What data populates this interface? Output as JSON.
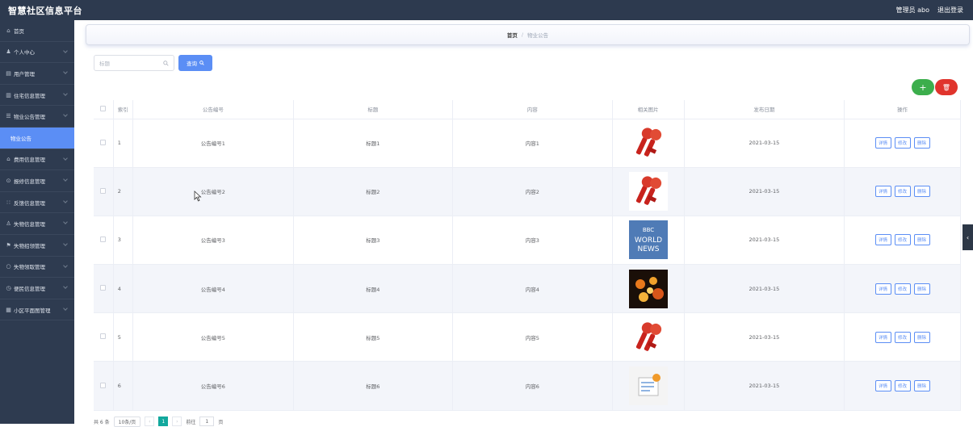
{
  "header": {
    "app_title": "智慧社区信息平台",
    "user_label": "管理员 abo",
    "logout": "退出登录"
  },
  "sidebar": {
    "items": [
      {
        "icon": "home-icon",
        "glyph": "⌂",
        "label": "首页",
        "chevron": false
      },
      {
        "icon": "user-icon",
        "glyph": "♟",
        "label": "个人中心",
        "chevron": true
      },
      {
        "icon": "users-icon",
        "glyph": "▤",
        "label": "用户管理",
        "chevron": true
      },
      {
        "icon": "building-icon",
        "glyph": "▥",
        "label": "住宅信息管理",
        "chevron": true
      },
      {
        "icon": "notice-icon",
        "glyph": "☰",
        "label": "物业公告管理",
        "chevron": true
      },
      {
        "label": "物业公告",
        "active": true,
        "chevron": false
      },
      {
        "icon": "bank-icon",
        "glyph": "⌂",
        "label": "费用信息管理",
        "chevron": true
      },
      {
        "icon": "repair-icon",
        "glyph": "⊙",
        "label": "报修信息管理",
        "chevron": true
      },
      {
        "icon": "feedback-icon",
        "glyph": "∷",
        "label": "反馈信息管理",
        "chevron": true
      },
      {
        "icon": "lost-icon",
        "glyph": "♙",
        "label": "失物信息管理",
        "chevron": true
      },
      {
        "icon": "flag-icon",
        "glyph": "⚑",
        "label": "失物招领管理",
        "chevron": true
      },
      {
        "icon": "claim-icon",
        "glyph": "○",
        "label": "失物领取管理",
        "chevron": true
      },
      {
        "icon": "clock-icon",
        "glyph": "◷",
        "label": "便民信息管理",
        "chevron": true
      },
      {
        "icon": "map-icon",
        "glyph": "▦",
        "label": "小区平面图管理",
        "chevron": true
      }
    ]
  },
  "breadcrumb": {
    "home": "首页",
    "sep": "/",
    "current": "物业公告"
  },
  "search": {
    "placeholder": "标题",
    "button": "查询"
  },
  "actions": {
    "add": "+",
    "delete": "🗑"
  },
  "table": {
    "headers": {
      "index": "索引",
      "no": "公告编号",
      "title": "标题",
      "content": "内容",
      "image": "相关图片",
      "date": "发布日期",
      "ops": "操作"
    },
    "rows": [
      {
        "index": "1",
        "no": "公告编号1",
        "title": "标题1",
        "content": "内容1",
        "image": "mic",
        "date": "2021-03-15"
      },
      {
        "index": "2",
        "no": "公告编号2",
        "title": "标题2",
        "content": "内容2",
        "image": "mic",
        "date": "2021-03-15"
      },
      {
        "index": "3",
        "no": "公告编号3",
        "title": "标题3",
        "content": "内容3",
        "image": "bbc",
        "date": "2021-03-15"
      },
      {
        "index": "4",
        "no": "公告编号4",
        "title": "标题4",
        "content": "内容4",
        "image": "fire",
        "date": "2021-03-15"
      },
      {
        "index": "5",
        "no": "公告编号5",
        "title": "标题5",
        "content": "内容5",
        "image": "mic",
        "date": "2021-03-15"
      },
      {
        "index": "6",
        "no": "公告编号6",
        "title": "标题6",
        "content": "内容6",
        "image": "doc",
        "date": "2021-03-15"
      }
    ],
    "op_labels": {
      "detail": "详情",
      "edit": "修改",
      "delete": "删除"
    }
  },
  "bbc_text": {
    "logo": "BBC",
    "line1": "WORLD",
    "line2": "NEWS"
  },
  "pager": {
    "total": "共 6 条",
    "size": "10条/页",
    "prev": "‹",
    "page": "1",
    "next": "›",
    "goto": "前往",
    "goto_value": "1",
    "unit": "页"
  },
  "colors": {
    "primary": "#5b8ef5",
    "sidebar": "#2e3b50",
    "add": "#3cae4c",
    "danger": "#e0342c",
    "page_active": "#12a89d"
  }
}
